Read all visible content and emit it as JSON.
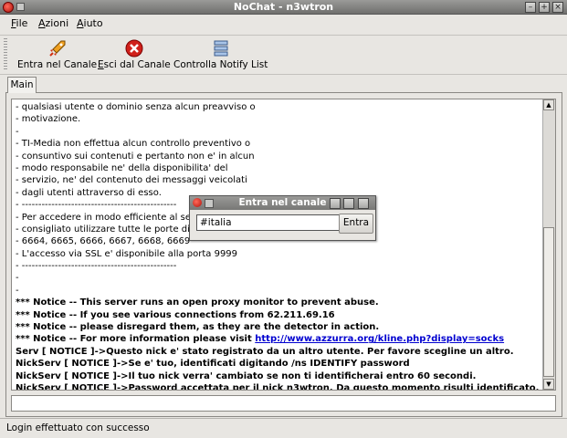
{
  "window": {
    "title": "NoChat - n3wtron"
  },
  "menu": [
    {
      "u": "F",
      "rest": "ile"
    },
    {
      "u": "A",
      "rest": "zioni"
    },
    {
      "u": "A",
      "rest": "iuto"
    }
  ],
  "toolbar": {
    "join": "Entra nel Canale",
    "leave_u": "E",
    "leave_rest": "sci dal Canale",
    "notify": "Controlla Notify List"
  },
  "tabs": [
    "Main"
  ],
  "chat_lines": [
    {
      "text": "- qualsiasi utente o dominio senza alcun preavviso o",
      "bold": false
    },
    {
      "text": "- motivazione.",
      "bold": false
    },
    {
      "text": "-",
      "bold": false
    },
    {
      "text": "- TI-Media non effettua alcun controllo preventivo o",
      "bold": false
    },
    {
      "text": "- consuntivo sui contenuti e pertanto non e' in alcun",
      "bold": false
    },
    {
      "text": "- modo responsabile ne' della disponibilita' del",
      "bold": false
    },
    {
      "text": "- servizio, ne' del contenuto dei messaggi veicolati",
      "bold": false
    },
    {
      "text": "- dagli utenti attraverso di esso.",
      "bold": false
    },
    {
      "text": "- -----------------------------------------------",
      "bold": false
    },
    {
      "text": "- Per accedere in modo efficiente al servizio",
      "bold": false
    },
    {
      "text": "- consigliato utilizzare tutte le porte disponibili",
      "bold": false
    },
    {
      "text": "- 6664, 6665, 6666, 6667, 6668, 6669",
      "bold": false
    },
    {
      "text": "- L'accesso via SSL e' disponibile alla porta 9999",
      "bold": false
    },
    {
      "text": "- -----------------------------------------------",
      "bold": false
    },
    {
      "text": "-",
      "bold": false
    },
    {
      "text": "-",
      "bold": false
    },
    {
      "text": "*** Notice -- This server runs an open proxy monitor to prevent abuse.",
      "bold": true
    },
    {
      "text": "*** Notice -- If you see various connections from 62.211.69.16",
      "bold": true
    },
    {
      "text": "*** Notice -- please disregard them, as they are the detector in action.",
      "bold": true
    },
    {
      "text": "*** Notice -- For more information please visit ",
      "bold": true,
      "link": "http://www.azzurra.org/kline.php?display=socks"
    },
    {
      "text": "Serv [ NOTICE ]->Questo nick e' stato registrato da un altro utente. Per favore scegline un altro.",
      "bold": true
    },
    {
      "text": "NickServ [ NOTICE ]->Se e' tuo, identificati digitando /ns IDENTIFY password",
      "bold": true
    },
    {
      "text": "NickServ [ NOTICE ]->Il tuo nick verra' cambiato se non ti identificherai entro 60 secondi.",
      "bold": true
    },
    {
      "text": "NickServ [ NOTICE ]->Password accettata per il nick n3wtron. Da questo momento risulti identificato.",
      "bold": true
    }
  ],
  "message_input": {
    "value": ""
  },
  "status": "Login effettuato con successo",
  "dialog": {
    "title": "Entra nel canale",
    "channel_value": "#italia",
    "ok_label": "Entra"
  },
  "colors": {
    "link": "#0000d0",
    "titlebar": "#8a8a88",
    "accent_red": "#d0201a"
  }
}
